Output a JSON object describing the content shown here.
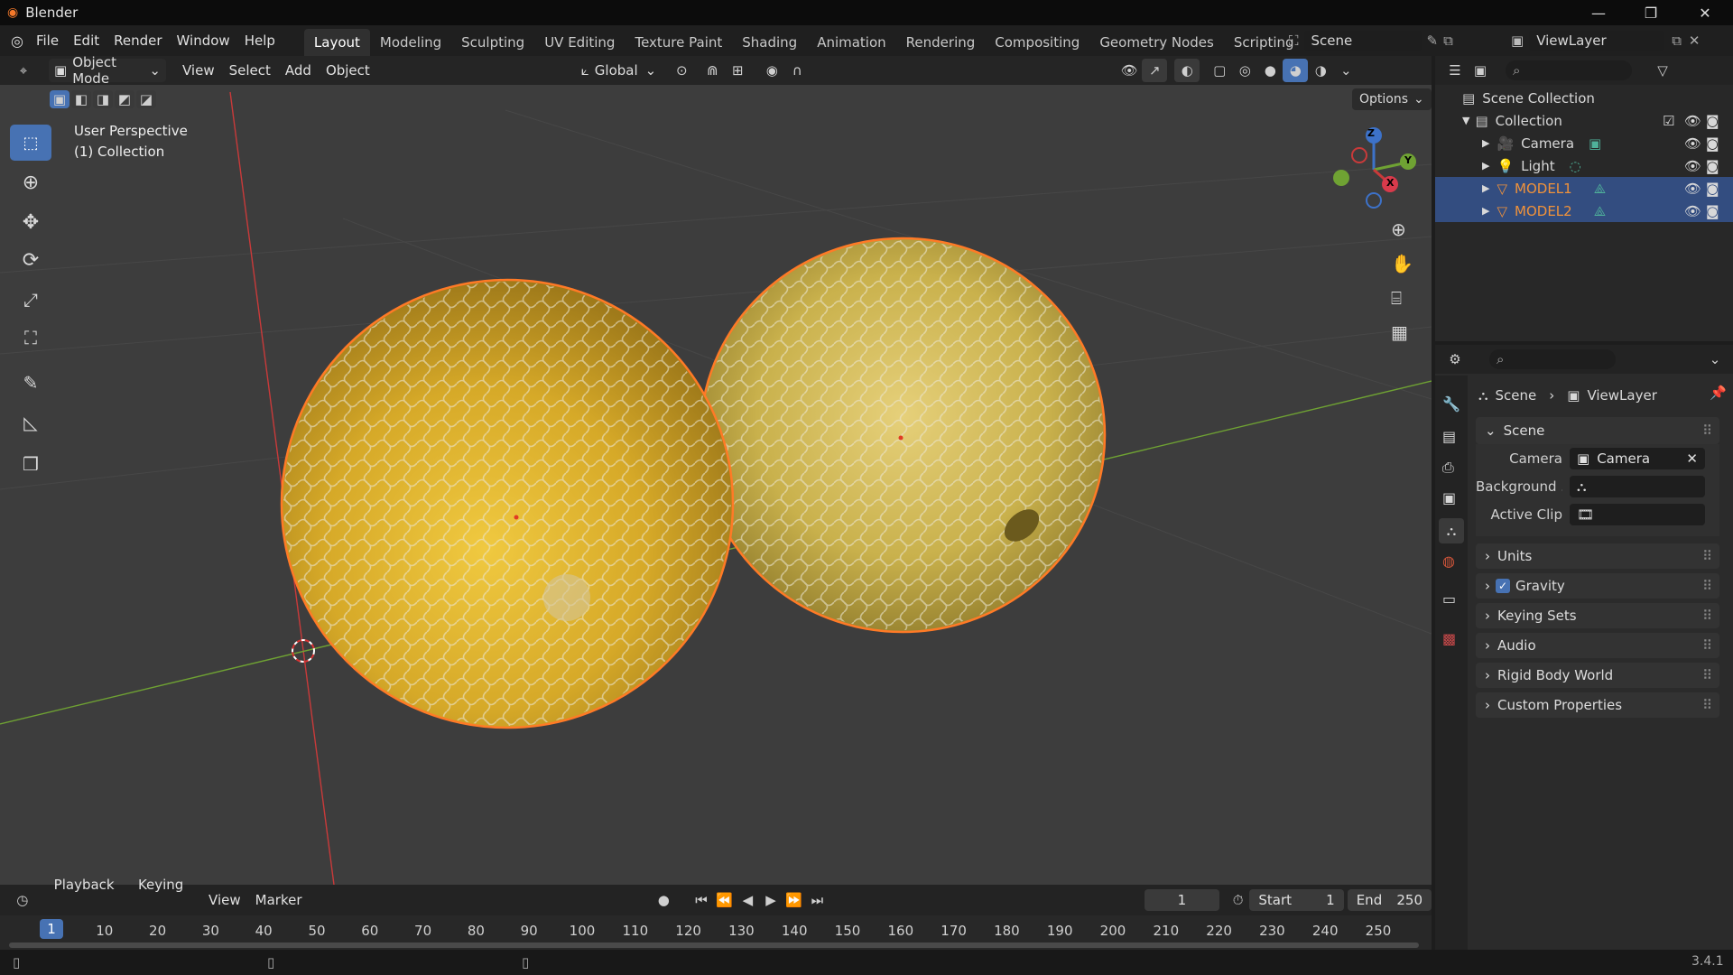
{
  "window": {
    "title": "Blender",
    "minimize": "—",
    "maximize": "❐",
    "close": "✕"
  },
  "menu": [
    "File",
    "Edit",
    "Render",
    "Window",
    "Help"
  ],
  "workspaces": {
    "active": "Layout",
    "tabs": [
      "Layout",
      "Modeling",
      "Sculpting",
      "UV Editing",
      "Texture Paint",
      "Shading",
      "Animation",
      "Rendering",
      "Compositing",
      "Geometry Nodes",
      "Scripting"
    ],
    "add": "+"
  },
  "scene_selector": {
    "value": "Scene"
  },
  "viewlayer_selector": {
    "value": "ViewLayer"
  },
  "viewport_header": {
    "mode": "Object Mode",
    "menus": [
      "View",
      "Select",
      "Add",
      "Object"
    ],
    "orientation": "Global",
    "options": "Options"
  },
  "viewport": {
    "perspective": "User Perspective",
    "collection": "(1) Collection",
    "gizmo": {
      "z": "Z",
      "y": "Y",
      "x": "X"
    },
    "colors": {
      "background": "#3d3d3d",
      "selection": "#ff7a26",
      "x_axis": "#c93a3a",
      "y_axis": "#6fa233",
      "melon": "#d4ab2a"
    }
  },
  "outliner": {
    "root": "Scene Collection",
    "collection": "Collection",
    "items": [
      {
        "name": "Camera",
        "type": "camera",
        "selected": false
      },
      {
        "name": "Light",
        "type": "light",
        "selected": false
      },
      {
        "name": "MODEL1",
        "type": "mesh",
        "selected": true
      },
      {
        "name": "MODEL2",
        "type": "mesh",
        "selected": true
      }
    ]
  },
  "properties": {
    "breadcrumb": {
      "scene": "Scene",
      "sep": "›",
      "viewlayer": "ViewLayer"
    },
    "scene_panel": {
      "title": "Scene",
      "fields": [
        {
          "label": "Camera",
          "value": "Camera"
        },
        {
          "label": "Background ...",
          "value": ""
        },
        {
          "label": "Active Clip",
          "value": ""
        }
      ]
    },
    "panels": [
      "Units",
      "Gravity",
      "Keying Sets",
      "Audio",
      "Rigid Body World",
      "Custom Properties"
    ],
    "gravity_checked": true
  },
  "timeline": {
    "menus": [
      "Playback",
      "Keying",
      "View",
      "Marker"
    ],
    "current_frame": "1",
    "start_label": "Start",
    "start": "1",
    "end_label": "End",
    "end": "250",
    "ticks": [
      "10",
      "20",
      "30",
      "40",
      "50",
      "60",
      "70",
      "80",
      "90",
      "100",
      "110",
      "120",
      "130",
      "140",
      "150",
      "160",
      "170",
      "180",
      "190",
      "200",
      "210",
      "220",
      "230",
      "240",
      "250"
    ]
  },
  "status": {
    "version": "3.4.1"
  }
}
